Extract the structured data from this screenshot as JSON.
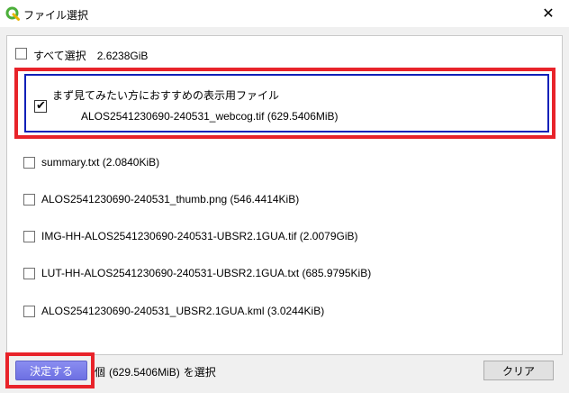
{
  "window": {
    "title": "ファイル選択",
    "close_glyph": "✕"
  },
  "select_all": {
    "label": "すべて選択",
    "size": "2.6238GiB",
    "checked": false
  },
  "recommended": {
    "checked": true,
    "heading": "まず見てみたい方におすすめの表示用ファイル",
    "file": "ALOS2541230690-240531_webcog.tif (629.5406MiB)"
  },
  "files": [
    {
      "label": "summary.txt (2.0840KiB)",
      "checked": false
    },
    {
      "label": "ALOS2541230690-240531_thumb.png (546.4414KiB)",
      "checked": false
    },
    {
      "label": "IMG-HH-ALOS2541230690-240531-UBSR2.1GUA.tif (2.0079GiB)",
      "checked": false
    },
    {
      "label": "LUT-HH-ALOS2541230690-240531-UBSR2.1GUA.txt (685.9795KiB)",
      "checked": false
    },
    {
      "label": "ALOS2541230690-240531_UBSR2.1GUA.kml (3.0244KiB)",
      "checked": false
    }
  ],
  "footer": {
    "confirm_label": "決定する",
    "selection_unit": "個",
    "selection_size": "(629.5406MiB)",
    "selection_suffix": "を選択",
    "clear_label": "クリア"
  },
  "colors": {
    "highlight_red": "#e8232a",
    "highlight_blue": "#1020b8",
    "primary_button": "#7b7eea",
    "qgis_green": "#4caf3a"
  },
  "icons": {
    "app": "qgis-logo-icon",
    "close": "close-icon",
    "check": "checkmark-icon"
  }
}
